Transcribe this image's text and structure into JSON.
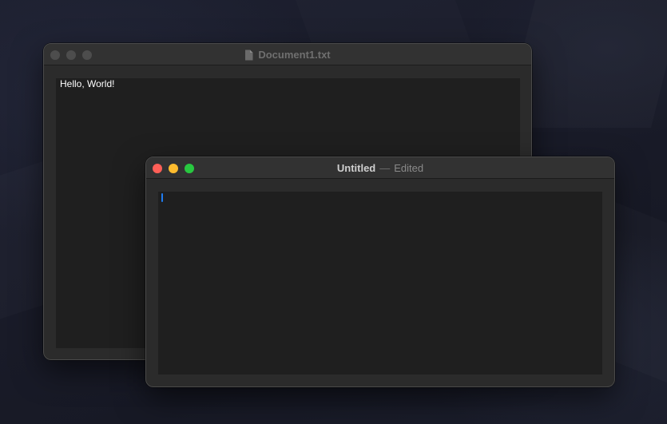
{
  "desktop": {
    "label": ""
  },
  "window_back": {
    "title": "Document1.txt",
    "title_icon": "document-icon",
    "content": "Hello, World!",
    "state": "inactive"
  },
  "window_front": {
    "title": "Untitled",
    "separator": "—",
    "status": "Edited",
    "content": "",
    "state": "active"
  },
  "colors": {
    "close": "#ff5f57",
    "minimize": "#febc2e",
    "zoom": "#28c840",
    "caret": "#1f7cf2",
    "inactive_traffic": "#4d4d4d",
    "editor_bg": "#1f1f1f",
    "window_bg": "#2b2b2b"
  }
}
